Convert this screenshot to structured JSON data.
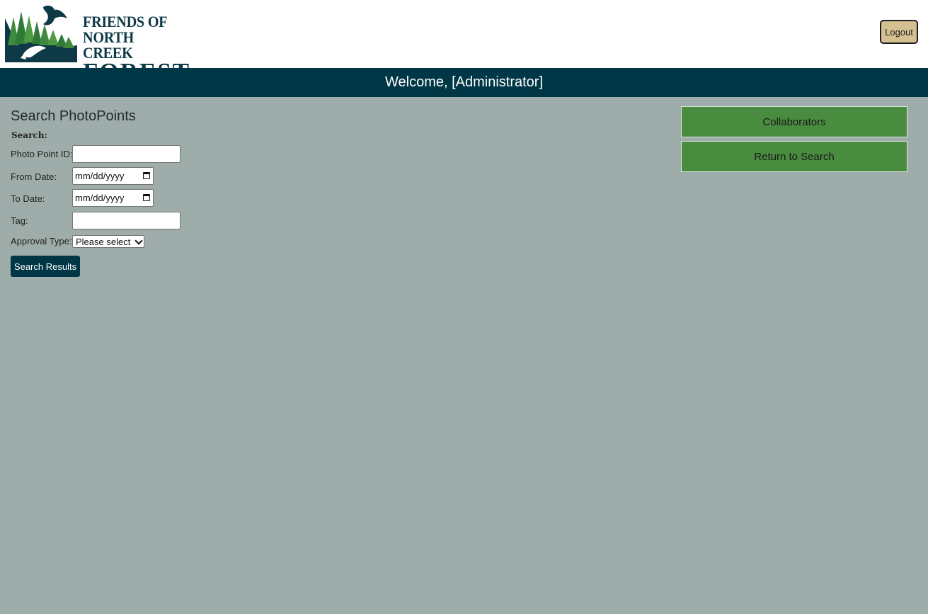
{
  "header": {
    "logo": {
      "line1": "FRIENDS OF",
      "line2": "NORTH CREEK",
      "line3": "FOREST",
      "colors": {
        "dark": "#0d3a46",
        "green": "#3f8a3c"
      }
    },
    "logout_label": "Logout"
  },
  "welcome": {
    "text": "Welcome, [Administrator]"
  },
  "search": {
    "title": "Search PhotoPoints",
    "section_label": "Search:",
    "photo_point_label": "Photo Point ID:",
    "photo_point_value": "",
    "from_date_label": "From Date:",
    "from_date_placeholder": "mm/dd/yyyy",
    "to_date_label": "To Date:",
    "to_date_placeholder": "mm/dd/yyyy",
    "tag_label": "Tag:",
    "tag_value": "",
    "approval_label": "Approval Type:",
    "approval_selected": "Please select",
    "submit_label": "Search Results"
  },
  "sidebar": {
    "collaborators_label": "Collaborators",
    "return_label": "Return to Search"
  },
  "colors": {
    "page_bg": "#9eadaa",
    "navy": "#003747",
    "green_button": "#4a8c3f",
    "logout_bg": "#d4c091"
  }
}
